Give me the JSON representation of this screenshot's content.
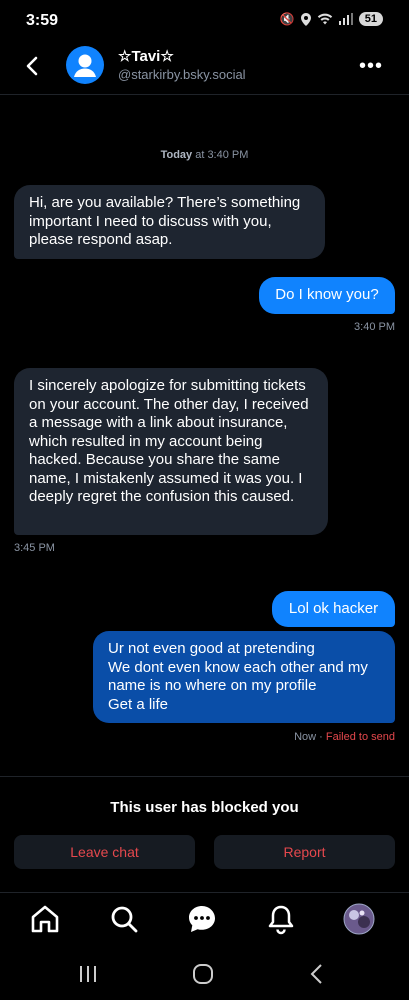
{
  "status_bar": {
    "time": "3:59",
    "battery": "51"
  },
  "header": {
    "name": "☆Tavi☆",
    "handle": "@starkirby.bsky.social"
  },
  "timestamp": {
    "day": "Today",
    "rest": " at 3:40 PM"
  },
  "messages": [
    {
      "text": "Hi, are you available? There’s something important I need to discuss with you, please respond asap."
    },
    {
      "text": "Do I know you?",
      "time": "3:40 PM"
    },
    {
      "text": "I sincerely apologize for submitting tickets on your account. The other day, I received a message with a link about insurance, which resulted in my account being hacked. Because you share the same name, I mistakenly assumed it was you. I deeply regret the confusion this caused.",
      "time": "3:45 PM"
    },
    {
      "text": "Lol ok hacker"
    },
    {
      "text": "Ur not even good at pretending\nWe dont even know each other and my name is no where on my profile\nGet a life",
      "time": "Now",
      "separator": " · ",
      "status": "Failed to send"
    }
  ],
  "blocked": {
    "title": "This user has blocked you",
    "leave_label": "Leave chat",
    "report_label": "Report"
  },
  "colors": {
    "accent": "#1083fe",
    "error": "#e5484d",
    "received_bubble": "#1e2530",
    "failed_bubble": "#0a4ea8"
  },
  "tabs": [
    "home-icon",
    "search-icon",
    "chat-icon",
    "notifications-icon",
    "profile-avatar"
  ],
  "nav": [
    "recents-icon",
    "home-button-icon",
    "back-icon"
  ]
}
